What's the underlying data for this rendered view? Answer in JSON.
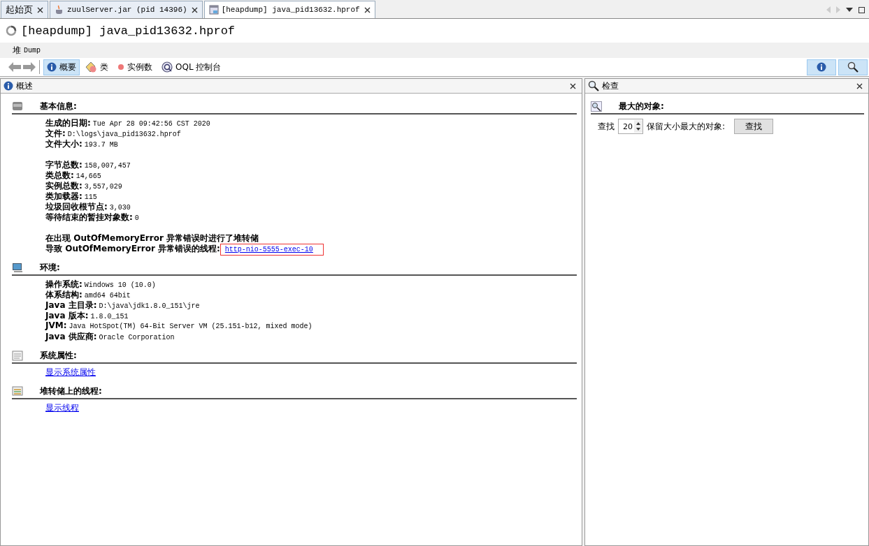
{
  "tabs": [
    {
      "label": "起始页",
      "kind": "plain",
      "selected": false
    },
    {
      "label": "zuulServer.jar (pid 14396)",
      "kind": "app",
      "selected": false
    },
    {
      "label": "[heapdump] java_pid13632.hprof",
      "kind": "dump",
      "selected": true
    }
  ],
  "title": "[heapdump] java_pid13632.hprof",
  "subtitle": {
    "label": "堆",
    "value": "Dump"
  },
  "views": [
    {
      "label": "概要",
      "kind": "info",
      "selected": true
    },
    {
      "label": "类",
      "kind": "classes",
      "selected": false
    },
    {
      "label": "实例数",
      "kind": "instances",
      "selected": false
    },
    {
      "label": "OQL 控制台",
      "kind": "oql",
      "selected": false
    }
  ],
  "toggles": [
    {
      "kind": "info",
      "selected": true
    },
    {
      "kind": "search",
      "selected": true
    }
  ],
  "left_panel": {
    "title": "概述",
    "sections": [
      {
        "title": "基本信息:",
        "kind": "memory",
        "groups": [
          [
            {
              "kind": "field",
              "label": "生成的日期:",
              "value": "Tue Apr 28 09:42:56 CST 2020"
            },
            {
              "kind": "field",
              "label": "文件:",
              "value": "D:\\logs\\java_pid13632.hprof"
            },
            {
              "kind": "field",
              "label": "文件大小:",
              "value": "193.7 MB"
            }
          ],
          [
            {
              "kind": "field",
              "label": "字节总数:",
              "value": "158,007,457"
            },
            {
              "kind": "field",
              "label": "类总数:",
              "value": "14,665"
            },
            {
              "kind": "field",
              "label": "实例总数:",
              "value": "3,557,029"
            },
            {
              "kind": "field",
              "label": "类加载器:",
              "value": "115"
            },
            {
              "kind": "field",
              "label": "垃圾回收根节点:",
              "value": "3,030"
            },
            {
              "kind": "field",
              "label": "等待结束的暂挂对象数:",
              "value": "0"
            }
          ],
          [
            {
              "kind": "note",
              "text": "在出现 OutOfMemoryError 异常错误时进行了堆转储"
            },
            {
              "kind": "linkfield",
              "label": "导致 OutOfMemoryError 异常错误的线程:",
              "value": "http-nio-5555-exec-10",
              "highlighted": true
            }
          ]
        ]
      },
      {
        "title": "环境:",
        "kind": "computer",
        "groups": [
          [
            {
              "kind": "field",
              "label": "操作系统:",
              "value": "Windows 10 (10.0)"
            },
            {
              "kind": "field",
              "label": "体系结构:",
              "value": "amd64 64bit"
            },
            {
              "kind": "field",
              "label": "Java 主目录:",
              "value": "D:\\java\\jdk1.8.0_151\\jre"
            },
            {
              "kind": "field",
              "label": "Java 版本:",
              "value": "1.8.0_151"
            },
            {
              "kind": "field",
              "label": "JVM:",
              "value": "Java HotSpot(TM) 64-Bit Server VM (25.151-b12, mixed mode)"
            },
            {
              "kind": "field",
              "label": "Java 供应商:",
              "value": "Oracle Corporation"
            }
          ]
        ]
      },
      {
        "title": "系统属性:",
        "kind": "document",
        "groups": [
          [
            {
              "kind": "link",
              "text": "显示系统属性"
            }
          ]
        ]
      },
      {
        "title": "堆转储上的线程:",
        "kind": "threads",
        "groups": [
          [
            {
              "kind": "link",
              "text": "显示线程"
            }
          ]
        ]
      }
    ]
  },
  "right_panel": {
    "title": "检查",
    "section": "最大的对象:",
    "find_label": "查找",
    "count": "20",
    "suffix": "保留大小最大的对象:",
    "button": "查找"
  }
}
